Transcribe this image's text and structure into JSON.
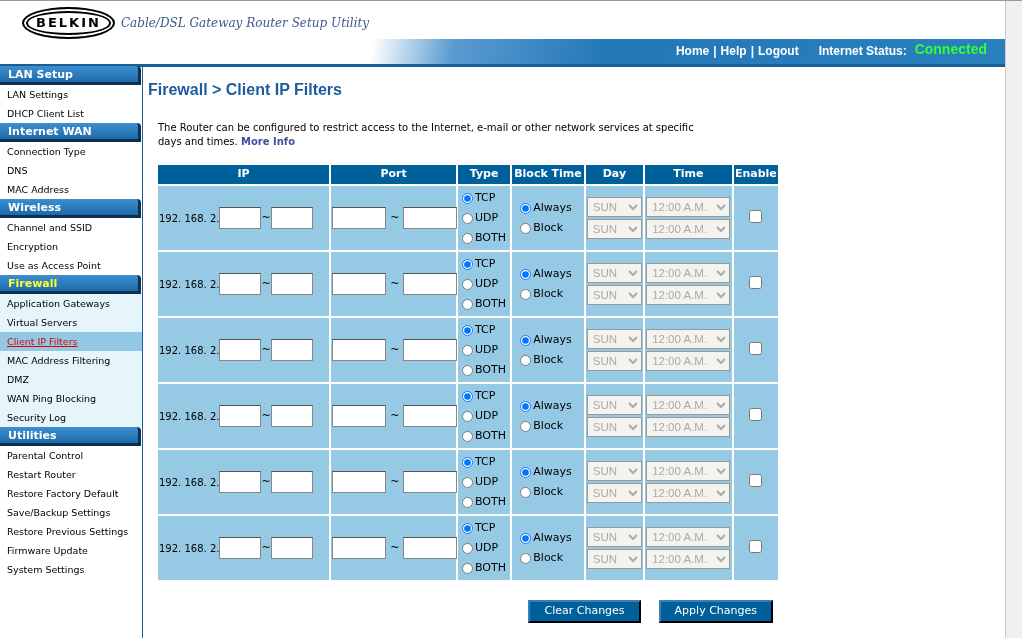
{
  "header": {
    "logo": "BELKIN",
    "title": "Cable/DSL Gateway Router Setup Utility",
    "links": [
      "Home",
      "Help",
      "Logout"
    ],
    "separator": "|",
    "status_label": "Internet Status:",
    "status_value": "Connected"
  },
  "sidebar": {
    "sections": [
      {
        "title": "LAN Setup",
        "expanded": false,
        "items": [
          {
            "label": "LAN Settings",
            "selected": false
          },
          {
            "label": "DHCP Client List",
            "selected": false
          }
        ]
      },
      {
        "title": "Internet WAN",
        "expanded": false,
        "items": [
          {
            "label": "Connection Type",
            "selected": false
          },
          {
            "label": "DNS",
            "selected": false
          },
          {
            "label": "MAC Address",
            "selected": false
          }
        ]
      },
      {
        "title": "Wireless",
        "expanded": false,
        "items": [
          {
            "label": "Channel and SSID",
            "selected": false
          },
          {
            "label": "Encryption",
            "selected": false
          },
          {
            "label": "Use as Access Point",
            "selected": false
          }
        ]
      },
      {
        "title": "Firewall",
        "expanded": true,
        "items": [
          {
            "label": "Application Gateways",
            "selected": false
          },
          {
            "label": "Virtual Servers",
            "selected": false
          },
          {
            "label": "Client IP Filters",
            "selected": true
          },
          {
            "label": "MAC Address Filtering",
            "selected": false
          },
          {
            "label": "DMZ",
            "selected": false
          },
          {
            "label": "WAN Ping Blocking",
            "selected": false
          },
          {
            "label": "Security Log",
            "selected": false
          }
        ]
      },
      {
        "title": "Utilities",
        "expanded": false,
        "items": [
          {
            "label": "Parental Control",
            "selected": false
          },
          {
            "label": "Restart Router",
            "selected": false
          },
          {
            "label": "Restore Factory Default",
            "selected": false
          },
          {
            "label": "Save/Backup Settings",
            "selected": false
          },
          {
            "label": "Restore Previous Settings",
            "selected": false
          },
          {
            "label": "Firmware Update",
            "selected": false
          },
          {
            "label": "System Settings",
            "selected": false
          }
        ]
      }
    ]
  },
  "page": {
    "title": "Firewall > Client IP Filters",
    "description": "The Router can be configured to restrict access to the Internet, e-mail or other network services at specific days and times.",
    "more_info": "More Info"
  },
  "table": {
    "columns": [
      "IP",
      "Port",
      "Type",
      "Block Time",
      "Day",
      "Time",
      "Enable"
    ],
    "range_separator": "~",
    "rows": [
      {
        "ip_prefix": "192. 168. 2.",
        "type": [
          {
            "label": "TCP",
            "selected": true
          },
          {
            "label": "UDP",
            "selected": false
          },
          {
            "label": "BOTH",
            "selected": false
          }
        ],
        "block_time": [
          {
            "label": "Always",
            "selected": true
          },
          {
            "label": "Block",
            "selected": false
          }
        ],
        "days": [
          "SUN",
          "SUN"
        ],
        "times": [
          "12:00 A.M.",
          "12:00 A.M."
        ],
        "schedule_disabled": true,
        "enabled": false
      },
      {
        "ip_prefix": "192. 168. 2.",
        "type": [
          {
            "label": "TCP",
            "selected": true
          },
          {
            "label": "UDP",
            "selected": false
          },
          {
            "label": "BOTH",
            "selected": false
          }
        ],
        "block_time": [
          {
            "label": "Always",
            "selected": true
          },
          {
            "label": "Block",
            "selected": false
          }
        ],
        "days": [
          "SUN",
          "SUN"
        ],
        "times": [
          "12:00 A.M.",
          "12:00 A.M."
        ],
        "schedule_disabled": true,
        "enabled": false
      },
      {
        "ip_prefix": "192. 168. 2.",
        "type": [
          {
            "label": "TCP",
            "selected": true
          },
          {
            "label": "UDP",
            "selected": false
          },
          {
            "label": "BOTH",
            "selected": false
          }
        ],
        "block_time": [
          {
            "label": "Always",
            "selected": true
          },
          {
            "label": "Block",
            "selected": false
          }
        ],
        "days": [
          "SUN",
          "SUN"
        ],
        "times": [
          "12:00 A.M.",
          "12:00 A.M."
        ],
        "schedule_disabled": true,
        "enabled": false
      },
      {
        "ip_prefix": "192. 168. 2.",
        "type": [
          {
            "label": "TCP",
            "selected": true
          },
          {
            "label": "UDP",
            "selected": false
          },
          {
            "label": "BOTH",
            "selected": false
          }
        ],
        "block_time": [
          {
            "label": "Always",
            "selected": true
          },
          {
            "label": "Block",
            "selected": false
          }
        ],
        "days": [
          "SUN",
          "SUN"
        ],
        "times": [
          "12:00 A.M.",
          "12:00 A.M."
        ],
        "schedule_disabled": true,
        "enabled": false
      },
      {
        "ip_prefix": "192. 168. 2.",
        "type": [
          {
            "label": "TCP",
            "selected": true
          },
          {
            "label": "UDP",
            "selected": false
          },
          {
            "label": "BOTH",
            "selected": false
          }
        ],
        "block_time": [
          {
            "label": "Always",
            "selected": true
          },
          {
            "label": "Block",
            "selected": false
          }
        ],
        "days": [
          "SUN",
          "SUN"
        ],
        "times": [
          "12:00 A.M.",
          "12:00 A.M."
        ],
        "schedule_disabled": true,
        "enabled": false
      },
      {
        "ip_prefix": "192. 168. 2.",
        "type": [
          {
            "label": "TCP",
            "selected": true
          },
          {
            "label": "UDP",
            "selected": false
          },
          {
            "label": "BOTH",
            "selected": false
          }
        ],
        "block_time": [
          {
            "label": "Always",
            "selected": true
          },
          {
            "label": "Block",
            "selected": false
          }
        ],
        "days": [
          "SUN",
          "SUN"
        ],
        "times": [
          "12:00 A.M.",
          "12:00 A.M."
        ],
        "schedule_disabled": true,
        "enabled": false
      }
    ]
  },
  "buttons": [
    "Clear Changes",
    "Apply Changes"
  ]
}
